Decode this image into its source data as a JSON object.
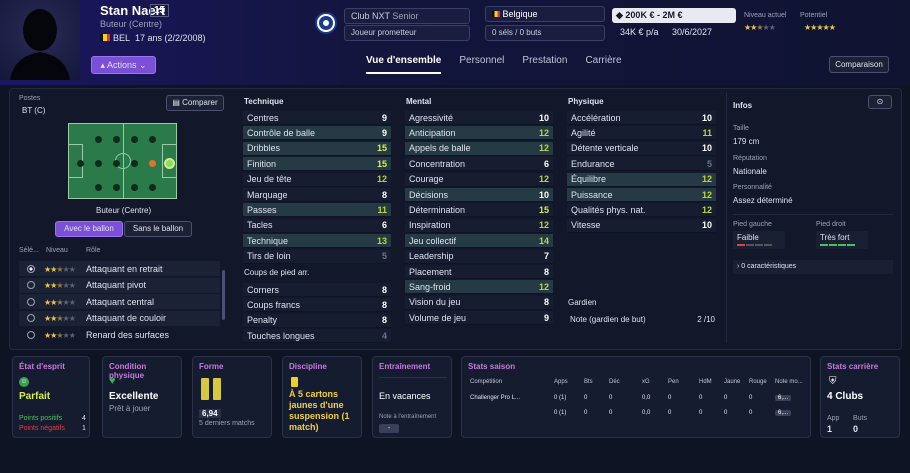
{
  "player": {
    "name": "Stan Naert",
    "number": "15",
    "position": "Buteur (Centre)",
    "nationality_code": "BEL",
    "age": "17 ans (2/2/2008)",
    "actions": "Actions"
  },
  "club": {
    "name": "Club NXT",
    "level": "Senior",
    "status": "Joueur prometteur",
    "country": "Belgique",
    "selections": "0 séls / 0 buts"
  },
  "value": {
    "range": "200K € - 2M €",
    "wage": "34K € p/a",
    "expiry": "30/6/2027"
  },
  "ability": {
    "current_label": "Niveau actuel",
    "potential_label": "Potentiel",
    "current_stars": 2.5,
    "potential_stars": 5
  },
  "tabs": [
    "Vue d'ensemble",
    "Personnel",
    "Prestation",
    "Carrière"
  ],
  "comparison_button": "Comparaison",
  "left": {
    "positions_label": "Postes",
    "position_code": "BT (C)",
    "compare_button": "Comparer",
    "pitch_label": "Buteur (Centre)",
    "with_ball": "Avec le ballon",
    "without_ball": "Sans le ballon",
    "role_headers": [
      "Sélé...",
      "Niveau",
      "Rôle"
    ],
    "roles": [
      {
        "name": "Attaquant en retrait",
        "stars": 2.5,
        "selected": true
      },
      {
        "name": "Attaquant pivot",
        "stars": 2.5,
        "selected": false
      },
      {
        "name": "Attaquant central",
        "stars": 2.5,
        "selected": false
      },
      {
        "name": "Attaquant de couloir",
        "stars": 2.5,
        "selected": false
      },
      {
        "name": "Renard des surfaces",
        "stars": 2.5,
        "selected": false
      }
    ]
  },
  "attributes": {
    "technique_title": "Technique",
    "technique": [
      [
        "Centres",
        "9"
      ],
      [
        "Contrôle de balle",
        "9"
      ],
      [
        "Dribbles",
        "15"
      ],
      [
        "Finition",
        "15"
      ],
      [
        "Jeu de tête",
        "12"
      ],
      [
        "Marquage",
        "8"
      ],
      [
        "Passes",
        "11"
      ],
      [
        "Tacles",
        "6"
      ],
      [
        "Technique",
        "13"
      ],
      [
        "Tirs de loin",
        "5"
      ]
    ],
    "setpieces_title": "Coups de pied arr.",
    "setpieces": [
      [
        "Corners",
        "8"
      ],
      [
        "Coups francs",
        "8"
      ],
      [
        "Penalty",
        "8"
      ],
      [
        "Touches longues",
        "4"
      ]
    ],
    "mental_title": "Mental",
    "mental": [
      [
        "Agressivité",
        "10"
      ],
      [
        "Anticipation",
        "12"
      ],
      [
        "Appels de balle",
        "12"
      ],
      [
        "Concentration",
        "6"
      ],
      [
        "Courage",
        "12"
      ],
      [
        "Décisions",
        "10"
      ],
      [
        "Détermination",
        "15"
      ],
      [
        "Inspiration",
        "12"
      ],
      [
        "Jeu collectif",
        "14"
      ],
      [
        "Leadership",
        "7"
      ],
      [
        "Placement",
        "8"
      ],
      [
        "Sang-froid",
        "12"
      ],
      [
        "Vision du jeu",
        "8"
      ],
      [
        "Volume de jeu",
        "9"
      ]
    ],
    "physical_title": "Physique",
    "physical": [
      [
        "Accélération",
        "10"
      ],
      [
        "Agilité",
        "11"
      ],
      [
        "Détente verticale",
        "10"
      ],
      [
        "Endurance",
        "5"
      ],
      [
        "Équilibre",
        "12"
      ],
      [
        "Puissance",
        "12"
      ],
      [
        "Qualités phys. nat.",
        "12"
      ],
      [
        "Vitesse",
        "10"
      ]
    ],
    "goalkeeper_title": "Gardien",
    "goalkeeper": [
      [
        "Note (gardien de but)",
        "2 /10"
      ]
    ]
  },
  "info": {
    "title": "Infos",
    "height_label": "Taille",
    "height": "179 cm",
    "reputation_label": "Réputation",
    "reputation": "Nationale",
    "personality_label": "Personnalité",
    "personality": "Assez déterminé",
    "left_foot_label": "Pied gauche",
    "left_foot": "Faible",
    "right_foot_label": "Pied droit",
    "right_foot": "Très fort",
    "traits": "0 caractéristiques"
  },
  "cards": {
    "mood": {
      "title": "État d'esprit",
      "value": "Parfait",
      "pos_label": "Points positifs",
      "pos": "4",
      "neg_label": "Points négatifs",
      "neg": "1"
    },
    "condition": {
      "title": "Condition physique",
      "value": "Excellente",
      "sub": "Prêt à jouer"
    },
    "form": {
      "title": "Forme",
      "rating": "6,94",
      "sub": "5 derniers matchs"
    },
    "discipline": {
      "title": "Discipline",
      "text": "À 5 cartons jaunes d'une suspension (1 match)"
    },
    "training": {
      "title": "Entraînement",
      "value": "En vacances",
      "note_label": "Note à l'entraînement",
      "note": "-"
    },
    "season": {
      "title": "Stats saison",
      "headers": [
        "Compétition",
        "Apps",
        "Bts",
        "Déc",
        "xG",
        "Pen",
        "HdM",
        "Jaune",
        "Rouge",
        "Note mo..."
      ],
      "rows": [
        [
          "Challenger Pro L...",
          "0 (1)",
          "0",
          "0",
          "0,0",
          "0",
          "0",
          "0",
          "0",
          "6,..."
        ],
        [
          "",
          "0 (1)",
          "0",
          "0",
          "0,0",
          "0",
          "0",
          "0",
          "0",
          "6,..."
        ]
      ]
    },
    "career": {
      "title": "Stats carrière",
      "clubs": "4 Clubs",
      "apps_label": "App",
      "apps": "1",
      "goals_label": "Buts",
      "goals": "0"
    }
  },
  "colors": {
    "accent": "#7b4fd6",
    "good": "#d8ef4a",
    "highlight_row": "#253a45"
  }
}
